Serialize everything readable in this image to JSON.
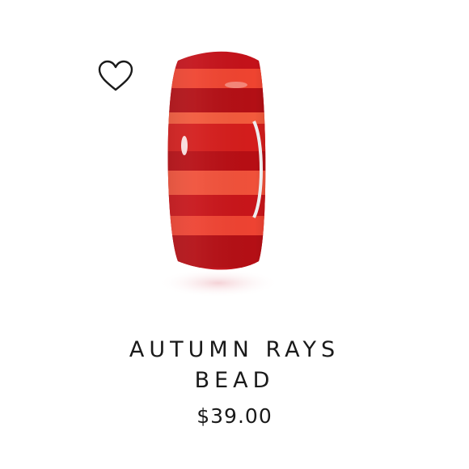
{
  "product": {
    "title_line1": "AUTUMN RAYS",
    "title_line2": "BEAD",
    "price": "$39.00",
    "image_icon": "red-striped-glass-bead",
    "wishlist_icon": "heart-outline-icon"
  },
  "colors": {
    "text": "#1a1a1a",
    "bead_dark": "#b80f14",
    "bead_light": "#ee3a2a"
  }
}
